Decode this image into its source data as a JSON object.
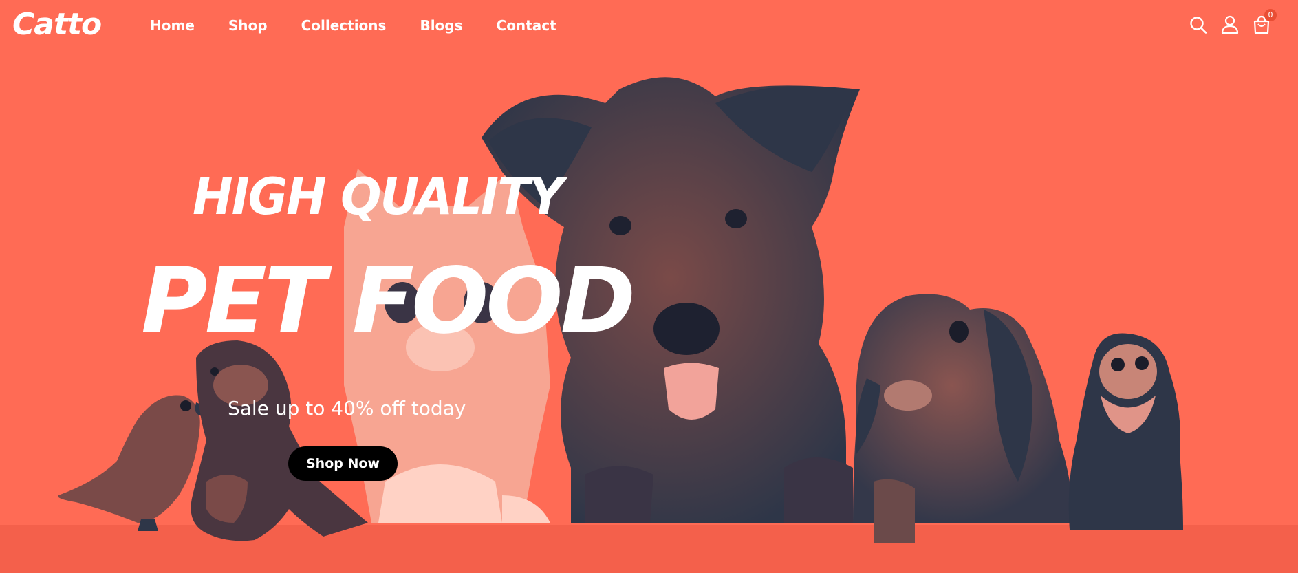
{
  "brand": {
    "logo": "Catto"
  },
  "nav": {
    "items": [
      {
        "label": "Home"
      },
      {
        "label": "Shop"
      },
      {
        "label": "Collections"
      },
      {
        "label": "Blogs"
      },
      {
        "label": "Contact"
      }
    ]
  },
  "header_icons": {
    "search": "search-icon",
    "account": "user-icon",
    "cart": "shopping-bag-icon",
    "cart_count": "0"
  },
  "hero": {
    "headline_line1": "HIGH QUALITY",
    "headline_line2": "PET FOOD",
    "subtitle": "Sale up to 40% off today",
    "cta_label": "Shop Now",
    "illustration": "pets-lineup-photo"
  },
  "colors": {
    "background": "#FF6B55",
    "silhouette": "#2E3648",
    "text": "#FFFFFF",
    "button": "#000000",
    "badge": "#E94E34"
  }
}
